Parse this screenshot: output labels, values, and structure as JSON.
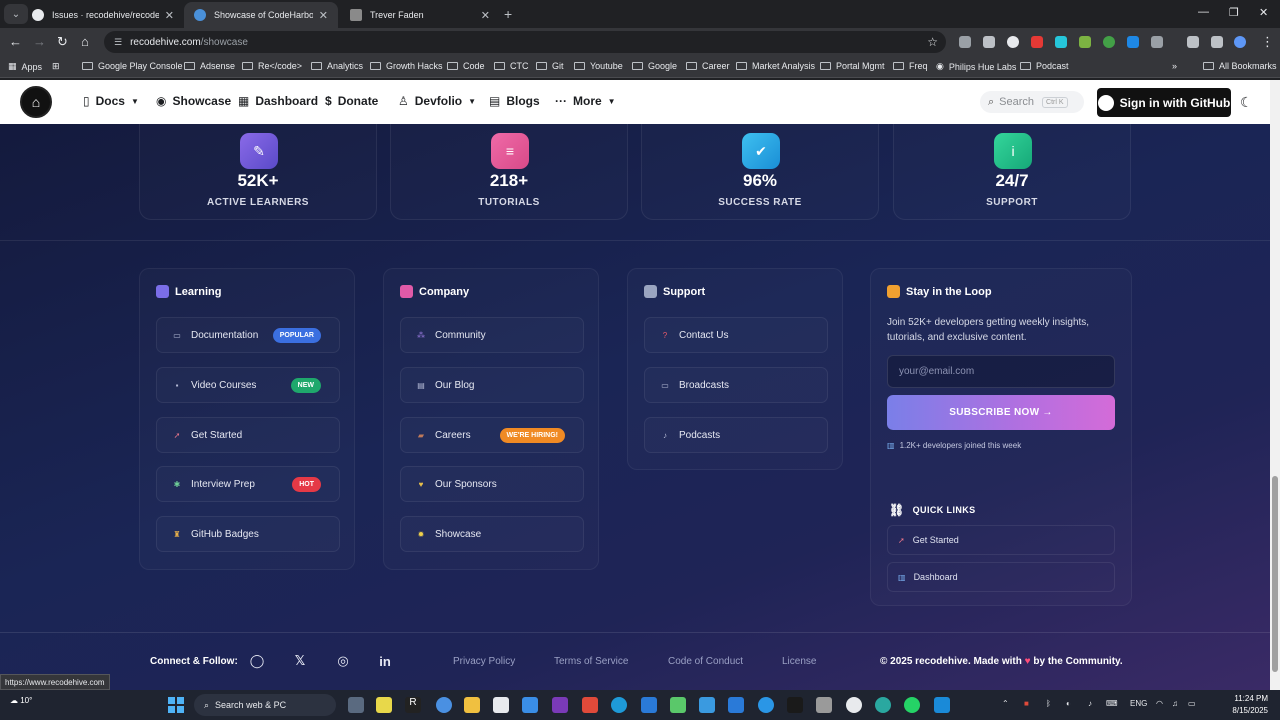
{
  "browser": {
    "tabs": [
      {
        "title": "Issues · recodehive/recode-web"
      },
      {
        "title": "Showcase of CodeHarborHub | "
      },
      {
        "title": "Trever Faden"
      }
    ],
    "url_host": "recodehive.com",
    "url_path": "/showcase",
    "bookmarks": [
      "Apps",
      "Google Play Console",
      "Adsense",
      "Re</code>",
      "Analytics",
      "Growth Hacks",
      "Code",
      "CTC",
      "Git",
      "Youtube",
      "Google",
      "Career",
      "Market Analysis",
      "Portal Mgmt",
      "Freq",
      "Philips Hue Labs",
      "Podcast",
      "All Bookmarks"
    ],
    "status_url": "https://www.recodehive.com"
  },
  "header": {
    "nav": [
      "Docs",
      "Showcase",
      "Dashboard",
      "Donate",
      "Devfolio",
      "Blogs",
      "More"
    ],
    "search_placeholder": "Search",
    "search_kbd": "Ctrl K",
    "github_button": "Sign in with GitHub"
  },
  "stats": [
    {
      "value": "52K+",
      "label": "ACTIVE LEARNERS",
      "color": "#7b5fd6"
    },
    {
      "value": "218+",
      "label": "TUTORIALS",
      "color": "#e8579a"
    },
    {
      "value": "96%",
      "label": "SUCCESS RATE",
      "color": "#1fa3e0"
    },
    {
      "value": "24/7",
      "label": "SUPPORT",
      "color": "#22c48b"
    }
  ],
  "columns": {
    "learning": {
      "title": "Learning",
      "links": [
        {
          "label": "Documentation",
          "badge": "POPULAR"
        },
        {
          "label": "Video Courses",
          "badge": "NEW"
        },
        {
          "label": "Get Started",
          "badge": ""
        },
        {
          "label": "Interview Prep",
          "badge": "HOT"
        },
        {
          "label": "GitHub Badges",
          "badge": ""
        }
      ]
    },
    "company": {
      "title": "Company",
      "links": [
        {
          "label": "Community",
          "badge": ""
        },
        {
          "label": "Our Blog",
          "badge": ""
        },
        {
          "label": "Careers",
          "badge": "WE'RE HIRING!"
        },
        {
          "label": "Our Sponsors",
          "badge": ""
        },
        {
          "label": "Showcase",
          "badge": ""
        }
      ]
    },
    "support": {
      "title": "Support",
      "links": [
        {
          "label": "Contact Us"
        },
        {
          "label": "Broadcasts"
        },
        {
          "label": "Podcasts"
        }
      ]
    }
  },
  "newsletter": {
    "title": "Stay in the Loop",
    "description": "Join 52K+ developers getting weekly insights, tutorials, and exclusive content.",
    "email_placeholder": "your@email.com",
    "subscribe_label": "SUBSCRIBE NOW →",
    "joined_text": "1.2K+ developers joined this week",
    "quick_links_title": "QUICK LINKS",
    "quick_links": [
      "Get Started",
      "Dashboard"
    ]
  },
  "footer": {
    "connect_label": "Connect & Follow:",
    "links": [
      "Privacy Policy",
      "Terms of Service",
      "Code of Conduct",
      "License"
    ],
    "copyright_prefix": "© 2025 recodehive. Made with",
    "copyright_suffix": "by the Community."
  },
  "taskbar": {
    "weather": "10°",
    "search_placeholder": "Search web & PC",
    "language": "ENG",
    "time": "11:24 PM",
    "date": "8/15/2025"
  }
}
